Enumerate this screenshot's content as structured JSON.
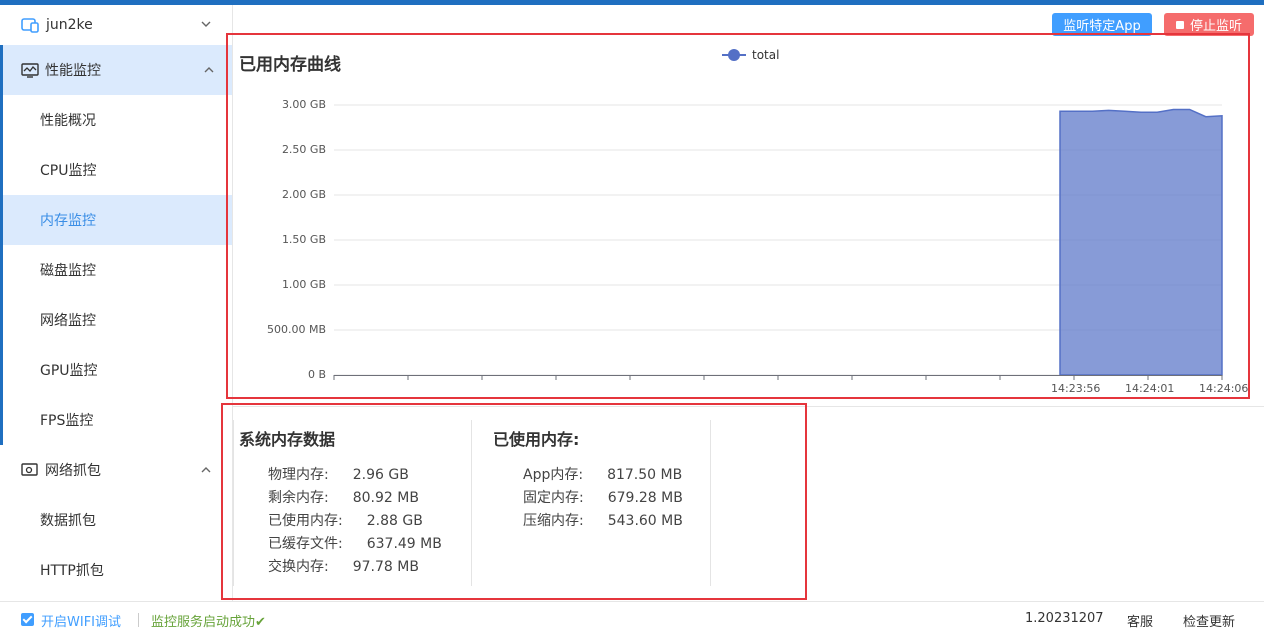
{
  "device": {
    "name": "jun2ke"
  },
  "sidebar": {
    "groups": [
      {
        "label": "性能监控",
        "items": [
          "性能概况",
          "CPU监控",
          "内存监控",
          "磁盘监控",
          "网络监控",
          "GPU监控",
          "FPS监控"
        ],
        "active_item": "内存监控"
      },
      {
        "label": "网络抓包",
        "items": [
          "数据抓包",
          "HTTP抓包"
        ]
      }
    ]
  },
  "toolbar": {
    "monitor_app_label": "监听特定App",
    "stop_label": "停止监听"
  },
  "chart": {
    "title": "已用内存曲线",
    "legend": "total",
    "y_ticks": [
      "3.00 GB",
      "2.50 GB",
      "2.00 GB",
      "1.50 GB",
      "1.00 GB",
      "500.00 MB",
      "0 B"
    ],
    "x_ticks": [
      "14:23:56",
      "14:24:01",
      "14:24:06"
    ]
  },
  "chart_data": {
    "type": "area",
    "title": "已用内存曲线",
    "series": [
      {
        "name": "total",
        "color": "#5470c6",
        "x": [
          "14:23:56",
          "14:23:57",
          "14:23:58",
          "14:23:59",
          "14:24:00",
          "14:24:01",
          "14:24:02",
          "14:24:03",
          "14:24:04",
          "14:24:05",
          "14:24:06"
        ],
        "values_gb": [
          2.93,
          2.93,
          2.93,
          2.94,
          2.93,
          2.92,
          2.92,
          2.95,
          2.95,
          2.87,
          2.88
        ]
      }
    ],
    "ylim_gb": [
      0,
      3
    ],
    "grid": true
  },
  "system_memory": {
    "title": "系统内存数据",
    "rows": [
      {
        "label": "物理内存:",
        "value": "2.96 GB"
      },
      {
        "label": "剩余内存:",
        "value": "80.92 MB"
      },
      {
        "label": "已使用内存:",
        "value": "2.88 GB"
      },
      {
        "label": "已缓存文件:",
        "value": "637.49 MB"
      },
      {
        "label": "交换内存:",
        "value": "97.78 MB"
      }
    ]
  },
  "used_memory": {
    "title": "已使用内存:",
    "rows": [
      {
        "label": "App内存:",
        "value": "817.50 MB"
      },
      {
        "label": "固定内存:",
        "value": "679.28 MB"
      },
      {
        "label": "压缩内存:",
        "value": "543.60 MB"
      }
    ]
  },
  "footer": {
    "wifi_debug_label": "开启WIFI调试",
    "status": "监控服务启动成功✔",
    "version": "1.20231207",
    "service_label": "客服",
    "update_label": "检查更新"
  }
}
